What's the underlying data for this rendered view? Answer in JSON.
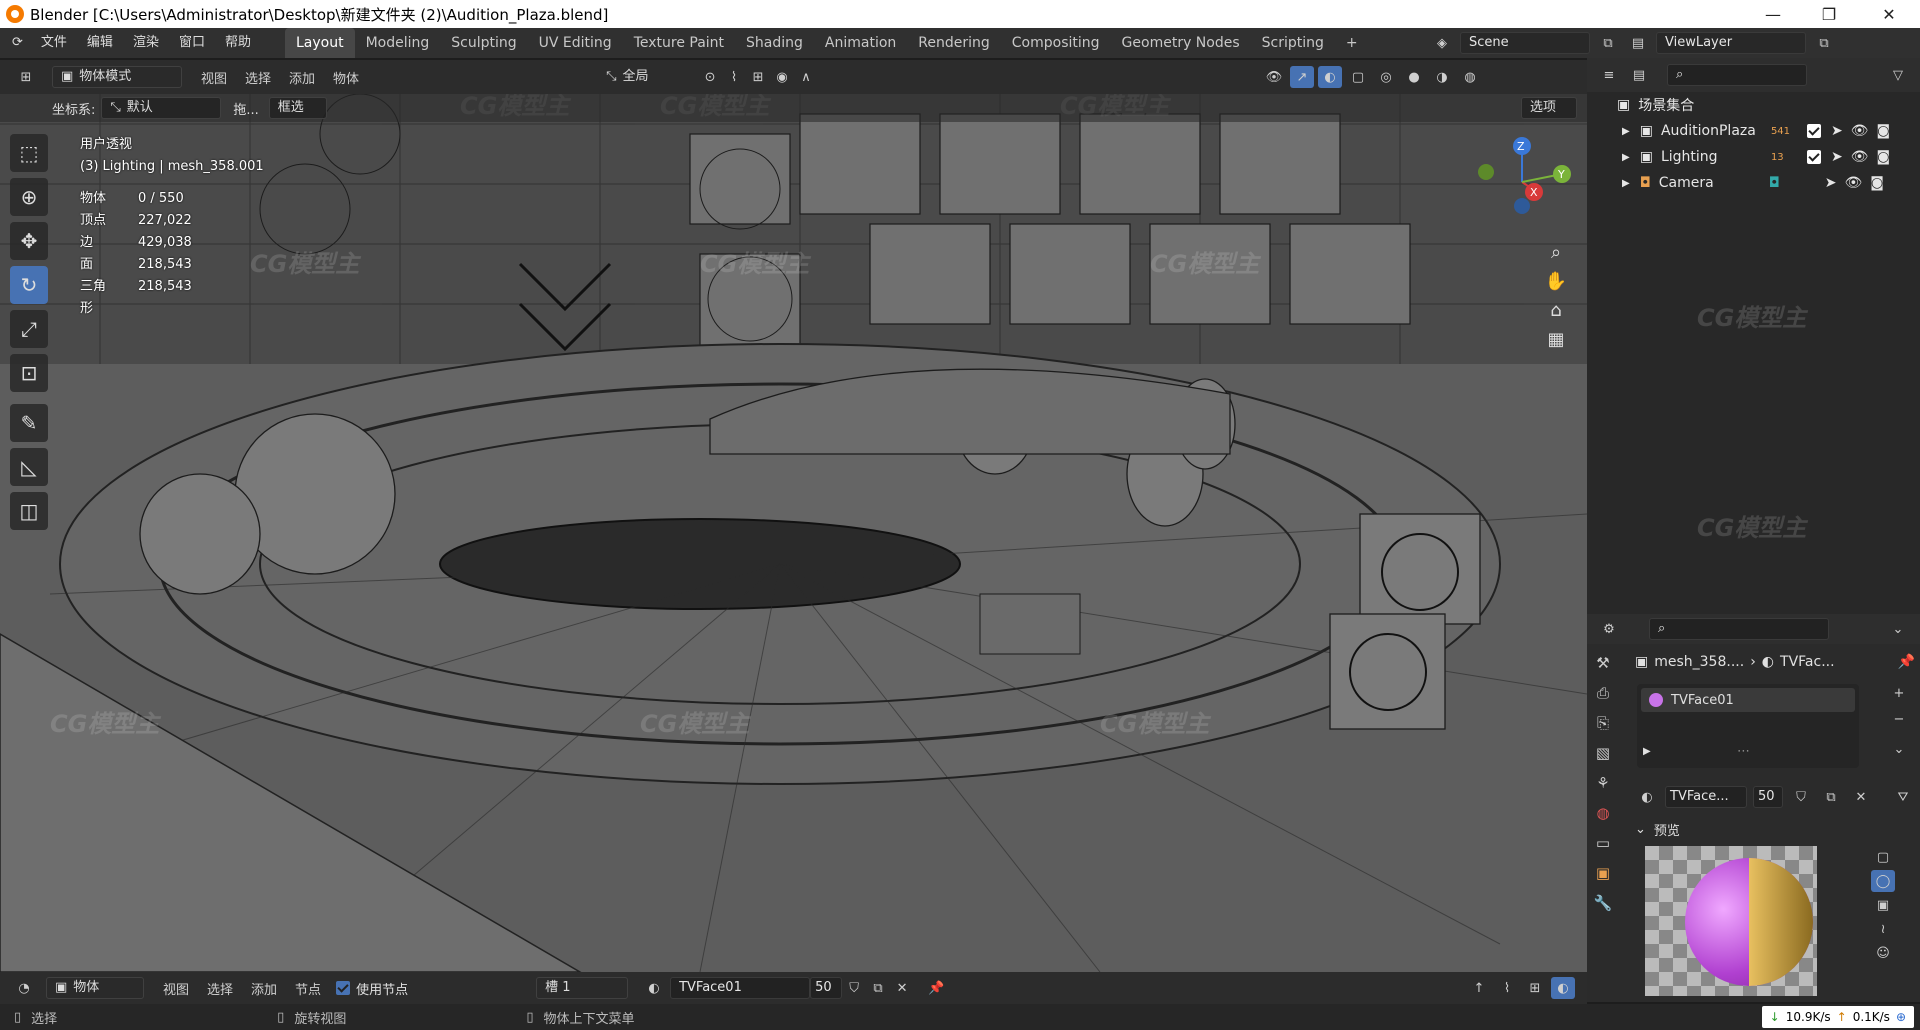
{
  "title": "Blender [C:\\Users\\Administrator\\Desktop\\新建文件夹 (2)\\Audition_Plaza.blend]",
  "menu": {
    "items": [
      "文件",
      "编辑",
      "渲染",
      "窗口",
      "帮助"
    ]
  },
  "workspaces": [
    "Layout",
    "Modeling",
    "Sculpting",
    "UV Editing",
    "Texture Paint",
    "Shading",
    "Animation",
    "Rendering",
    "Compositing",
    "Geometry Nodes",
    "Scripting"
  ],
  "scene": {
    "name": "Scene",
    "viewlayer": "ViewLayer"
  },
  "viewport_header": {
    "mode": "物体模式",
    "menus": [
      "视图",
      "选择",
      "添加",
      "物体"
    ],
    "transform": "全局",
    "coord_label": "坐标系:",
    "coord_value": "默认",
    "drag_label": "拖...",
    "select_mode": "框选",
    "options": "选项"
  },
  "overlay": {
    "view_name": "用户透视",
    "object_path": "(3) Lighting | mesh_358.001",
    "stats": [
      {
        "k": "物体",
        "v": "0 / 550"
      },
      {
        "k": "顶点",
        "v": "227,022"
      },
      {
        "k": "边",
        "v": "429,038"
      },
      {
        "k": "面",
        "v": "218,543"
      },
      {
        "k": "三角形",
        "v": "218,543"
      }
    ]
  },
  "gizmo": {
    "z": "Z",
    "x": "X",
    "y": "Y"
  },
  "outliner": {
    "title": "场景集合",
    "items": [
      {
        "label": "AuditionPlaza",
        "count": "541"
      },
      {
        "label": "Lighting",
        "count": "13"
      },
      {
        "label": "Camera",
        "count": ""
      }
    ]
  },
  "properties": {
    "breadcrumb_object": "mesh_358....",
    "breadcrumb_material": "TVFac...",
    "slot": "TVFace01",
    "material_name": "TVFace...",
    "users": "50",
    "preview_label": "预览"
  },
  "bottom": {
    "editor_mode": "物体",
    "menus": [
      "视图",
      "选择",
      "添加",
      "节点"
    ],
    "use_nodes": "使用节点",
    "slot": "槽 1",
    "material": "TVFace01",
    "users": "50"
  },
  "status": {
    "select": "选择",
    "rotate": "旋转视图",
    "context_menu": "物体上下文菜单",
    "down_speed": "10.9K/s",
    "up_speed": "0.1K/s"
  },
  "watermark": "CG模型主",
  "colors": {
    "accent": "#4772b3",
    "header": "#303030",
    "viewport": "#5a5a5a"
  }
}
